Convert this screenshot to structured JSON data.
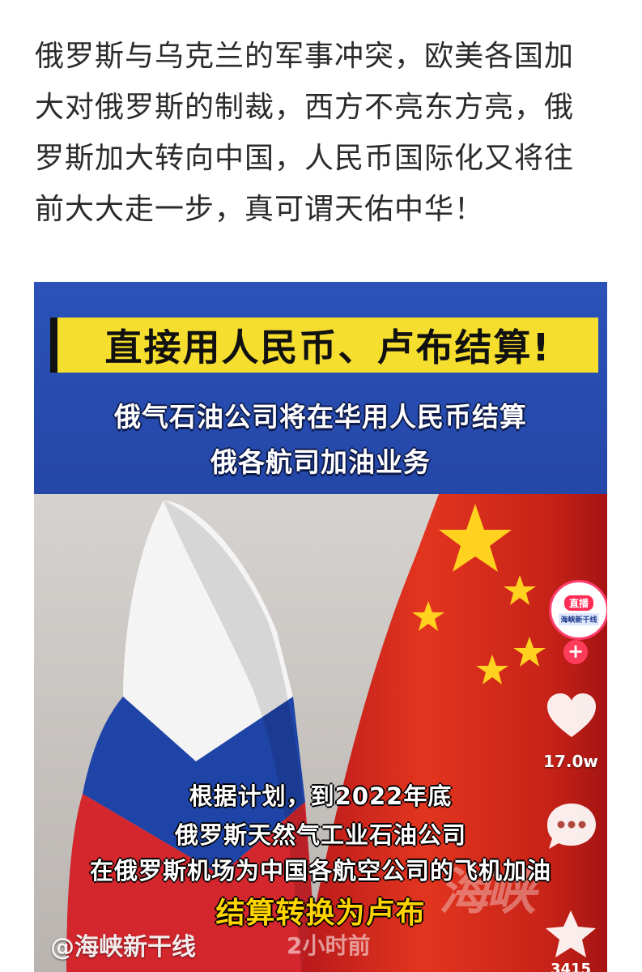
{
  "article": {
    "line1": "俄罗斯与乌克兰的军事冲突，欧美各国加",
    "line2": "大对俄罗斯的制裁，西方不亮东方亮，俄",
    "line3": "罗斯加大转向中国，人民币国际化又将往",
    "line4": "前大大走一步，真可谓天佑中华！"
  },
  "video": {
    "headline": "直接用人民币、卢布结算!",
    "subtitle_line1": "俄气石油公司将在华用人民币结算",
    "subtitle_line2": "俄各航司加油业务",
    "caption_line1": "根据计划，到2022年底",
    "caption_line2": "俄罗斯天然气工业石油公司",
    "caption_line3": "在俄罗斯机场为中国各航空公司的飞机加油",
    "caption_line4": "结算转换为卢布",
    "account": "@海峡新干线",
    "time": "2小时前",
    "watermark": "海峡"
  },
  "rail": {
    "live_label": "直播",
    "avatar_name": "海峡新干线",
    "follow": "+",
    "likes": "17.0w",
    "stars": "3415"
  },
  "colors": {
    "banner_blue": "#2a52b8",
    "headline_yellow": "#f6de2e",
    "live_pink": "#ff2d55"
  }
}
